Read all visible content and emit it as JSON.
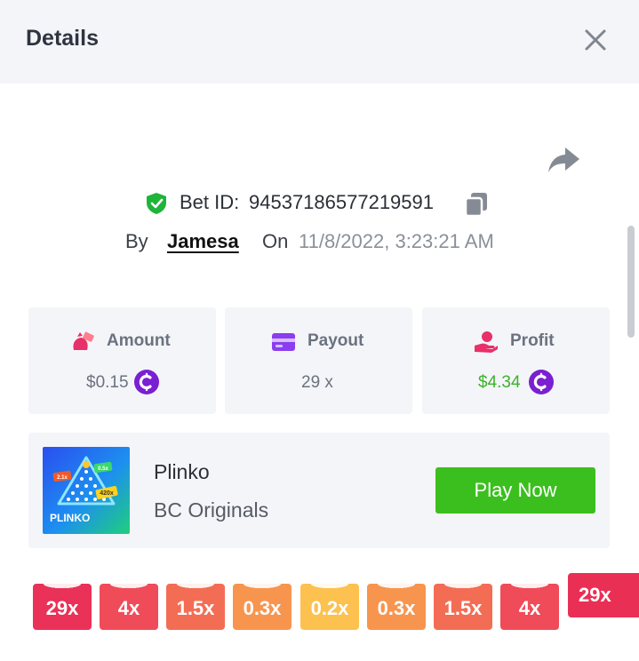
{
  "header": {
    "title": "Details"
  },
  "bet": {
    "id_label": "Bet ID:",
    "id_value": "94537186577219591",
    "by_label": "By",
    "user": "Jamesa",
    "on_label": "On",
    "date": "11/8/2022, 3:23:21 AM"
  },
  "stats": {
    "amount": {
      "label": "Amount",
      "value": "$0.15"
    },
    "payout": {
      "label": "Payout",
      "value": "29 x"
    },
    "profit": {
      "label": "Profit",
      "value": "$4.34"
    }
  },
  "game": {
    "name": "Plinko",
    "provider": "BC Originals",
    "play_label": "Play Now",
    "thumb_title": "PLINKO",
    "thumb_badges": [
      "2.1x",
      "0.5x",
      "420x"
    ]
  },
  "multipliers": [
    {
      "label": "29x",
      "color": "#ea3158"
    },
    {
      "label": "4x",
      "color": "#f04b58"
    },
    {
      "label": "1.5x",
      "color": "#f36d55"
    },
    {
      "label": "0.3x",
      "color": "#f7954f"
    },
    {
      "label": "0.2x",
      "color": "#fcc14f"
    },
    {
      "label": "0.3x",
      "color": "#f7954f"
    },
    {
      "label": "1.5x",
      "color": "#f36d55"
    },
    {
      "label": "4x",
      "color": "#f04b58"
    },
    {
      "label": "29x",
      "color": "#ea2f55"
    }
  ],
  "colors": {
    "profit_green": "#3bb22a",
    "play_green": "#3bbf1e",
    "coin_purple": "#7a1fd1",
    "verified_green": "#1fb43a"
  },
  "icons": {
    "close": "close-icon",
    "share": "share-icon",
    "verified": "shield-check-icon",
    "copy": "copy-icon",
    "amount": "money-bag-icon",
    "payout": "card-icon",
    "profit": "hand-coin-icon",
    "coin": "coin-icon"
  }
}
